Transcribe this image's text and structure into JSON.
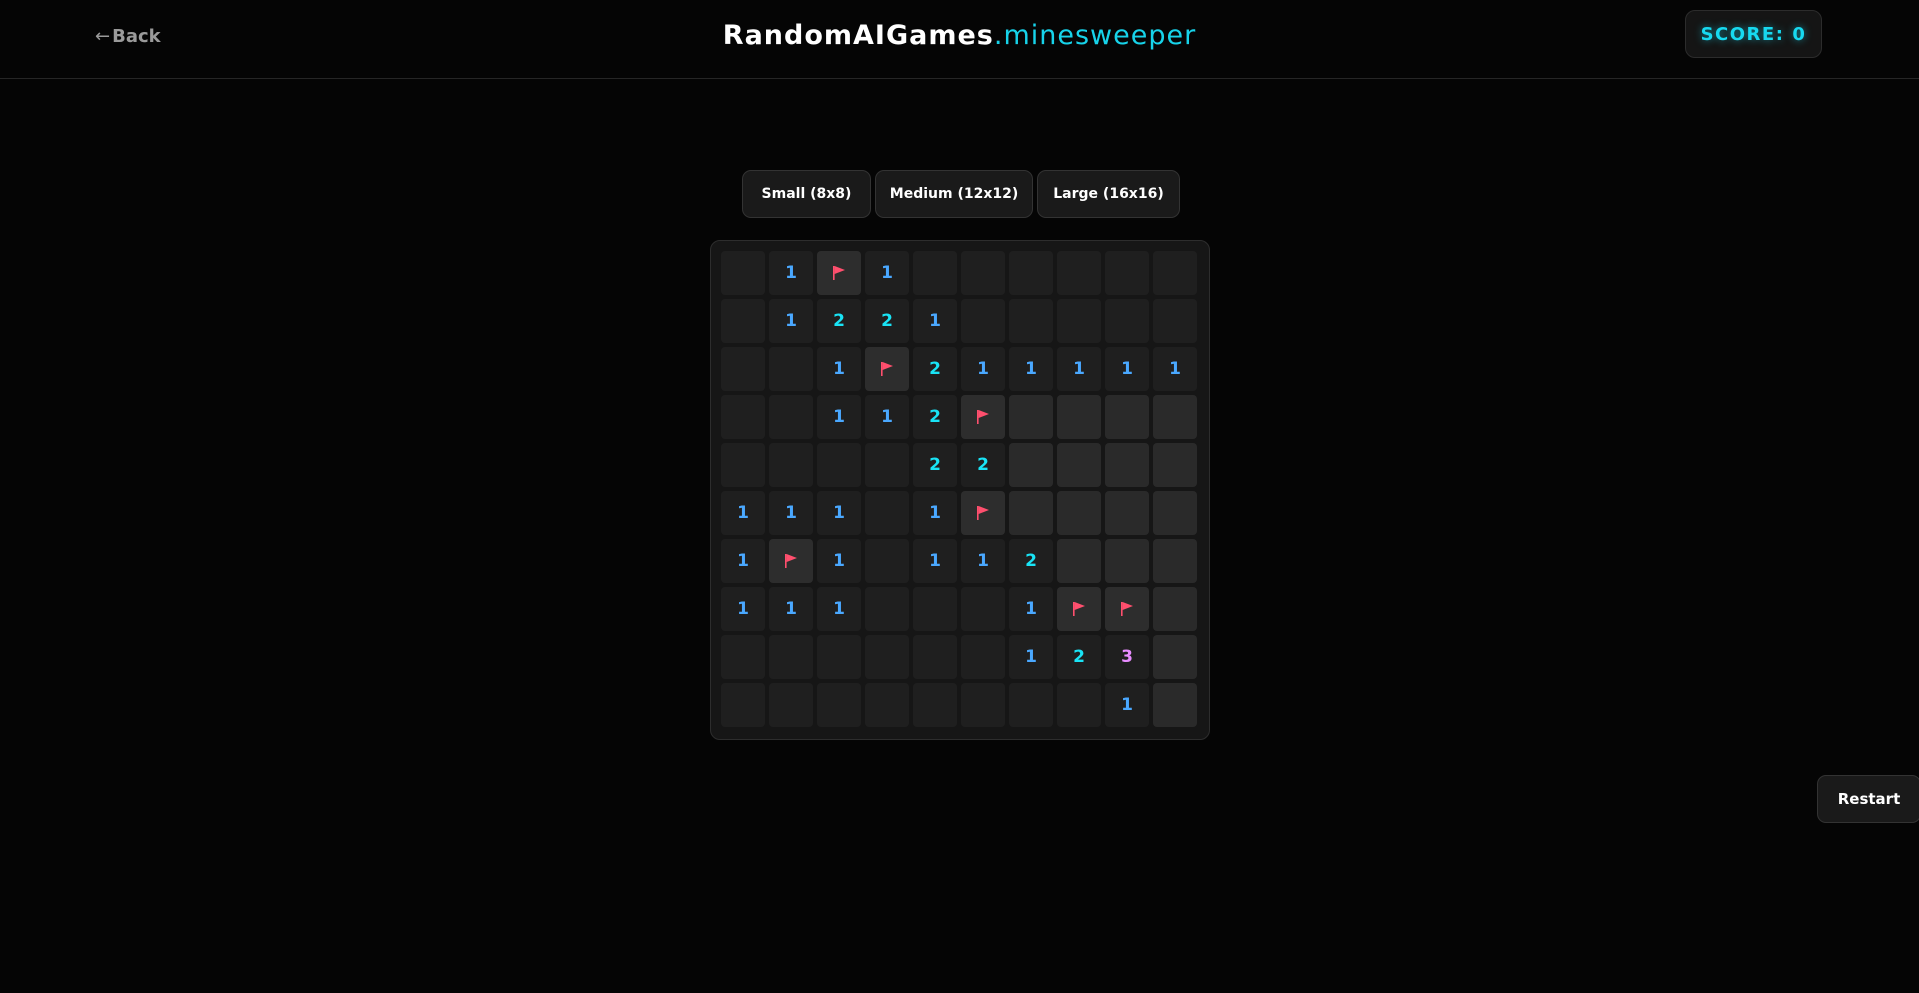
{
  "header": {
    "back_label": "Back",
    "back_arrow": "←",
    "brand_main": "RandomAIGames",
    "brand_sub": ".minesweeper",
    "score_label": "SCORE:",
    "score_value": "0"
  },
  "size_options": [
    "Small (8x8)",
    "Medium (12x12)",
    "Large (16x16)"
  ],
  "board": {
    "rows": 10,
    "cols": 10,
    "legend": {
      "E": "revealed-empty",
      "H": "hidden",
      "F": "flag",
      "1": "number",
      "2": "number",
      "3": "number"
    },
    "cells": [
      [
        "E",
        "1",
        "F",
        "1",
        "E",
        "E",
        "E",
        "E",
        "E",
        "E"
      ],
      [
        "E",
        "1",
        "2",
        "2",
        "1",
        "E",
        "E",
        "E",
        "E",
        "E"
      ],
      [
        "E",
        "E",
        "1",
        "F",
        "2",
        "1",
        "1",
        "1",
        "1",
        "1"
      ],
      [
        "E",
        "E",
        "1",
        "1",
        "2",
        "F",
        "H",
        "H",
        "H",
        "H"
      ],
      [
        "E",
        "E",
        "E",
        "E",
        "2",
        "2",
        "H",
        "H",
        "H",
        "H"
      ],
      [
        "1",
        "1",
        "1",
        "E",
        "1",
        "F",
        "H",
        "H",
        "H",
        "H"
      ],
      [
        "1",
        "F",
        "1",
        "E",
        "1",
        "1",
        "2",
        "H",
        "H",
        "H"
      ],
      [
        "1",
        "1",
        "1",
        "E",
        "E",
        "E",
        "1",
        "F",
        "F",
        "H"
      ],
      [
        "E",
        "E",
        "E",
        "E",
        "E",
        "E",
        "1",
        "2",
        "3",
        "H"
      ],
      [
        "E",
        "E",
        "E",
        "E",
        "E",
        "E",
        "E",
        "E",
        "1",
        "H"
      ]
    ]
  },
  "restart_label": "Restart",
  "colors": {
    "one": "#4aa8ff",
    "two": "#19e3f5",
    "three": "#e88cff",
    "flag": "#ff4f6e",
    "accent": "#17d3ea"
  },
  "icons": {
    "flag": "flag-icon",
    "back": "arrow-left-icon"
  }
}
